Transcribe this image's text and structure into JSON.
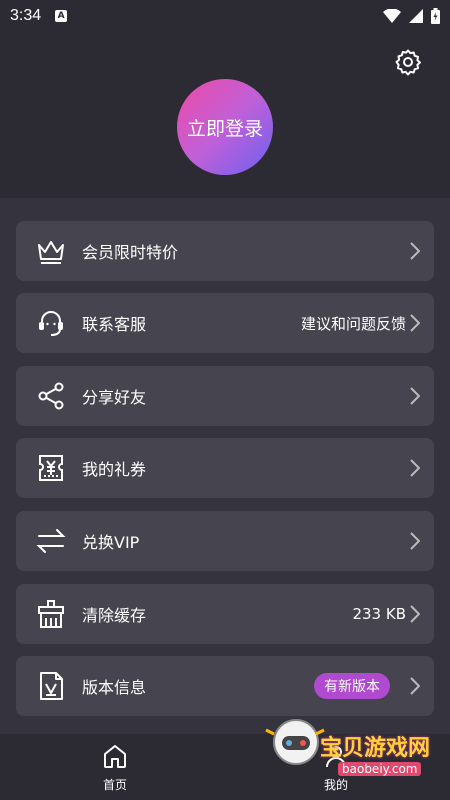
{
  "statusbar": {
    "time": "3:34",
    "a_icon": "A"
  },
  "header": {
    "login_label": "立即登录"
  },
  "menu": [
    {
      "label": "会员限时特价",
      "right": "",
      "badge": "",
      "icon": "crown-icon"
    },
    {
      "label": "联系客服",
      "right": "建议和问题反馈",
      "badge": "",
      "icon": "headset-icon"
    },
    {
      "label": "分享好友",
      "right": "",
      "badge": "",
      "icon": "share-icon"
    },
    {
      "label": "我的礼券",
      "right": "",
      "badge": "",
      "icon": "coupon-icon"
    },
    {
      "label": "兑换VIP",
      "right": "",
      "badge": "",
      "icon": "exchange-icon"
    },
    {
      "label": "清除缓存",
      "right": "233 KB",
      "badge": "",
      "icon": "clear-cache-icon"
    },
    {
      "label": "版本信息",
      "right": "",
      "badge": "有新版本",
      "icon": "version-info-icon"
    }
  ],
  "tabbar": {
    "home_label": "首页",
    "mine_label": "我的"
  },
  "watermark": {
    "title": "宝贝游戏网",
    "url": "baobeiy.com"
  },
  "colors": {
    "background": "#2c2b34",
    "card": "#46454f",
    "badge": "#b04ad0",
    "gradient_start": "#ef4aa6",
    "gradient_end": "#6b62f0"
  }
}
